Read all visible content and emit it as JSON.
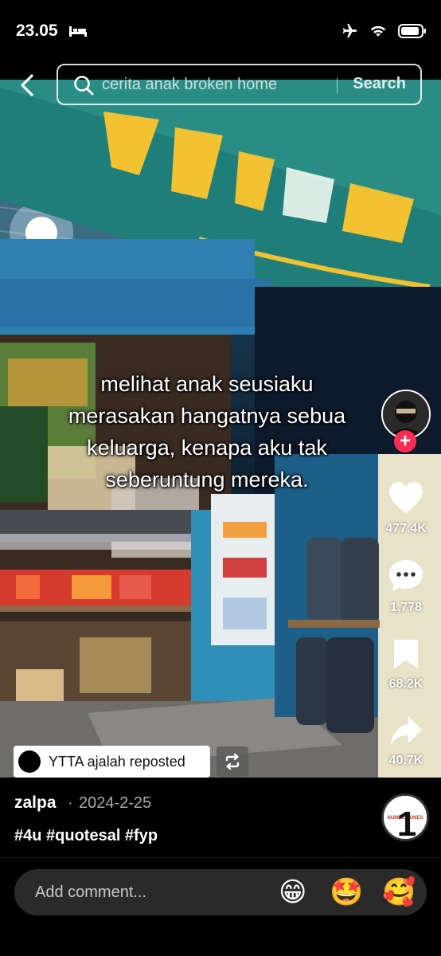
{
  "status_bar": {
    "time": "23.05"
  },
  "search": {
    "query": "cerita anak broken home",
    "button_label": "Search"
  },
  "caption": {
    "lines": [
      "melihat anak seusiaku",
      "merasakan hangatnya sebua",
      "keluarga, kenapa aku tak",
      "seberuntung mereka."
    ]
  },
  "actions": {
    "likes": "477.4K",
    "comments": "1,778",
    "bookmarks": "68.2K",
    "shares": "40.7K",
    "follow_glyph": "+"
  },
  "repost": {
    "label": "YTTA ajalah reposted"
  },
  "post": {
    "username": "zalpa",
    "separator": "·",
    "date": "2024-2-25",
    "hashtags": "#4u #quotesal #fyp",
    "music_label_small": "NUMBER ONES",
    "music_label_big": "1"
  },
  "comment_bar": {
    "placeholder": "Add comment...",
    "emojis": [
      "😁",
      "🤩",
      "🥰"
    ]
  },
  "colors": {
    "follow": "#fe2c55",
    "background": "#000000",
    "sign_yellow": "#f2c230",
    "sign_teal": "#1f7d7a"
  }
}
